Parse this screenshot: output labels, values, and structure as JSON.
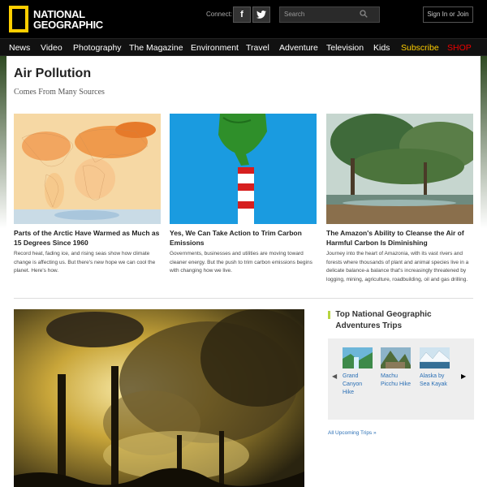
{
  "header": {
    "logo_line1": "NATIONAL",
    "logo_line2": "GEOGRAPHIC",
    "connect_label": "Connect:",
    "facebook_glyph": "f",
    "twitter_glyph": "t",
    "search_placeholder": "Search",
    "signin_label": "Sign In or Join"
  },
  "nav": {
    "items": [
      "News",
      "Video",
      "Photography",
      "The Magazine",
      "Environment",
      "Travel",
      "Adventure",
      "Television",
      "Kids"
    ],
    "subscribe": "Subscribe",
    "shop": "SHOP"
  },
  "page": {
    "title": "Air Pollution",
    "subtitle": "Comes From Many Sources"
  },
  "cards": [
    {
      "heading": "Parts of the Arctic Have Warmed as Much as 15 Degrees Since 1960",
      "desc": "Record heat, fading ice, and rising seas show how climate change is affecting us. But there's new hope we can cool the planet. Here's how."
    },
    {
      "heading": "Yes, We Can Take Action to Trim Carbon Emissions",
      "desc": "Governments, businesses and utilities are moving toward cleaner energy. But the push to trim carbon emissions begins with changing how we live."
    },
    {
      "heading": "The Amazon's Ability to Cleanse the Air of Harmful Carbon Is Diminishing",
      "desc": "Journey into the heart of Amazonia, with its vast rivers and forests where thousands of plant and animal species live in a delicate balance-a balance that's increasingly threatened by logging, mining, agriculture, roadbuilding, oil and gas drilling."
    }
  ],
  "trips": {
    "title": "Top National Geographic Adventures Trips",
    "items": [
      {
        "label_a": "Grand",
        "label_b": "Canyon",
        "label_c": "Hike"
      },
      {
        "label_a": "Machu",
        "label_b": "Picchu Hike",
        "label_c": ""
      },
      {
        "label_a": "Alaska by",
        "label_b": "Sea Kayak",
        "label_c": ""
      }
    ],
    "all_link": "All Upcoming Trips »"
  },
  "colors": {
    "brand_yellow": "#ffce00",
    "shop_red": "#ee0000",
    "link_blue": "#2a6fb5",
    "accent_green": "#b7d440"
  }
}
